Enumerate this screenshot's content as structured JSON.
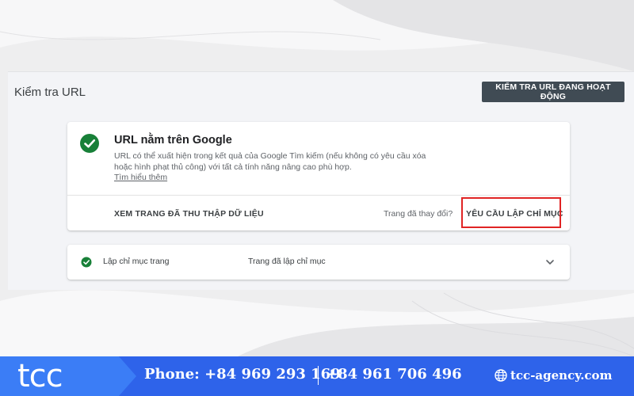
{
  "panel": {
    "title": "Kiểm tra URL",
    "live_test_label": "KIỂM TRA URL ĐANG HOẠT ĐỘNG"
  },
  "status_card": {
    "heading": "URL nằm trên Google",
    "description": "URL có thể xuất hiện trong kết quả của Google Tìm kiếm (nếu không có yêu cầu xóa hoặc hình phạt thủ công) với tất cả tính năng nâng cao phù hợp.",
    "learn_more": "Tìm hiểu thêm",
    "view_crawled_label": "XEM TRANG ĐÃ THU THẬP DỮ LIỆU",
    "page_changed_label": "Trang đã thay đổi?",
    "request_indexing_label": "YÊU CẦU LẬP CHỈ MỤC",
    "status_color": "#188038"
  },
  "indexing_row": {
    "label": "Lập chỉ mục trang",
    "value": "Trang đã lập chỉ mục"
  },
  "highlight_color": "#e02424",
  "footer": {
    "logo": "tcc",
    "phone_1": "Phone: +84 969 293 169",
    "phone_2": "+84 961 706 496",
    "website": "tcc-agency.com",
    "bg_color": "#2e63ea"
  },
  "icons": {
    "status": "check-circle-icon",
    "indexing": "check-circle-icon",
    "expand": "chevron-down-icon",
    "website": "globe-icon"
  }
}
